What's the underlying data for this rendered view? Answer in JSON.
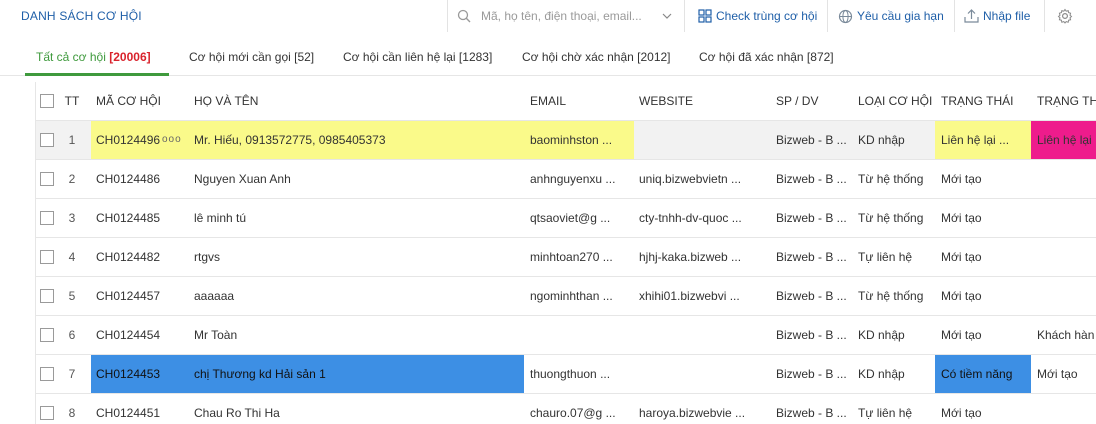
{
  "page_title": "DANH SÁCH CƠ HỘI",
  "search": {
    "placeholder": "Mã, họ tên, điện thoại, email..."
  },
  "toolbar": {
    "check_label": "Check trùng cơ hội",
    "request_label": "Yêu cầu gia hạn",
    "import_label": "Nhập file"
  },
  "tabs": [
    {
      "label": "Tất cả cơ hội",
      "count": "[20006]"
    },
    {
      "label": "Cơ hội mới cần gọi [52]"
    },
    {
      "label": "Cơ hội cần liên hệ lại [1283]"
    },
    {
      "label": "Cơ hội chờ xác nhận [2012]"
    },
    {
      "label": "Cơ hội đã xác nhận [872]"
    }
  ],
  "table": {
    "headers": {
      "tt": "TT",
      "ma": "MÃ CƠ HỘI",
      "ten": "HỌ VÀ TÊN",
      "email": "EMAIL",
      "website": "WEBSITE",
      "sp": "SP / DV",
      "loai": "LOẠI CƠ HỘI",
      "trangthai": "TRẠNG THÁI",
      "trangthai2": "TRẠNG TH"
    },
    "rows": [
      {
        "tt": "1",
        "ma": "CH0124496",
        "dots": "ooo",
        "ten": "Mr. Hiếu, 0913572775, 0985405373",
        "email": "baominhston ...",
        "website": "",
        "sp": "Bizweb - B ...",
        "loai": "KD nhập",
        "trangthai": "Liên hệ lại ...",
        "trangthai2": "Liên hệ lại"
      },
      {
        "tt": "2",
        "ma": "CH0124486",
        "ten": "Nguyen Xuan Anh",
        "email": "anhnguyenxu ...",
        "website": "uniq.bizwebvietn ...",
        "sp": "Bizweb - B ...",
        "loai": "Từ hệ thống",
        "trangthai": "Mới tạo",
        "trangthai2": ""
      },
      {
        "tt": "3",
        "ma": "CH0124485",
        "ten": "lê minh tú",
        "email": "qtsaoviet@g ...",
        "website": "cty-tnhh-dv-quoc ...",
        "sp": "Bizweb - B ...",
        "loai": "Từ hệ thống",
        "trangthai": "Mới tạo",
        "trangthai2": ""
      },
      {
        "tt": "4",
        "ma": "CH0124482",
        "ten": "rtgvs",
        "email": "minhtoan270 ...",
        "website": "hjhj-kaka.bizweb ...",
        "sp": "Bizweb - B ...",
        "loai": "Tự liên hệ",
        "trangthai": "Mới tạo",
        "trangthai2": ""
      },
      {
        "tt": "5",
        "ma": "CH0124457",
        "ten": "aaaaaa",
        "email": "ngominhthan ...",
        "website": "xhihi01.bizwebvi ...",
        "sp": "Bizweb - B ...",
        "loai": "Từ hệ thống",
        "trangthai": "Mới tạo",
        "trangthai2": ""
      },
      {
        "tt": "6",
        "ma": "CH0124454",
        "ten": "Mr Toàn",
        "email": "",
        "website": "",
        "sp": "Bizweb - B ...",
        "loai": "KD nhập",
        "trangthai": "Mới tạo",
        "trangthai2": "Khách hàn"
      },
      {
        "tt": "7",
        "ma": "CH0124453",
        "ten": "chị Thương kd Hải sản 1",
        "email": "thuongthuon ...",
        "website": "",
        "sp": "Bizweb - B ...",
        "loai": "KD nhập",
        "trangthai": "Có tiềm năng",
        "trangthai2": "Mới tạo"
      },
      {
        "tt": "8",
        "ma": "CH0124451",
        "ten": "Chau Ro Thi Ha",
        "email": "chauro.07@g ...",
        "website": "haroya.bizwebvie ...",
        "sp": "Bizweb - B ...",
        "loai": "Tự liên hệ",
        "trangthai": "Mới tạo",
        "trangthai2": ""
      }
    ]
  },
  "colors": {
    "accent": "#1f5fa8",
    "active_tab": "#3f9a3d",
    "count_red": "#d9232c",
    "highlight_yellow": "#fafa8a",
    "highlight_blue": "#3d8fe4",
    "highlight_pink": "#ee1c8c"
  }
}
